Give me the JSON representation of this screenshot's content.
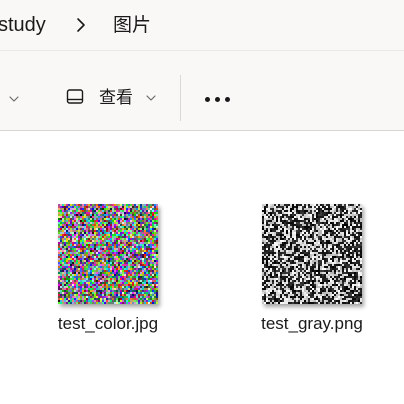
{
  "breadcrumb": {
    "items": [
      "study",
      "图片"
    ],
    "separator_icon": "chevron-right-icon"
  },
  "commandbar": {
    "view_label": "查看",
    "view_icon": "view-layout-icon",
    "more_icon": "more-options-icon"
  },
  "files": [
    {
      "name": "test_color.jpg",
      "thumbnail": "color noise image"
    },
    {
      "name": "test_gray.png",
      "thumbnail": "grayscale noise image"
    }
  ],
  "colors": {
    "chrome_background": "#f9f8f6",
    "content_background": "#ffffff",
    "text": "#1a1a1a"
  }
}
